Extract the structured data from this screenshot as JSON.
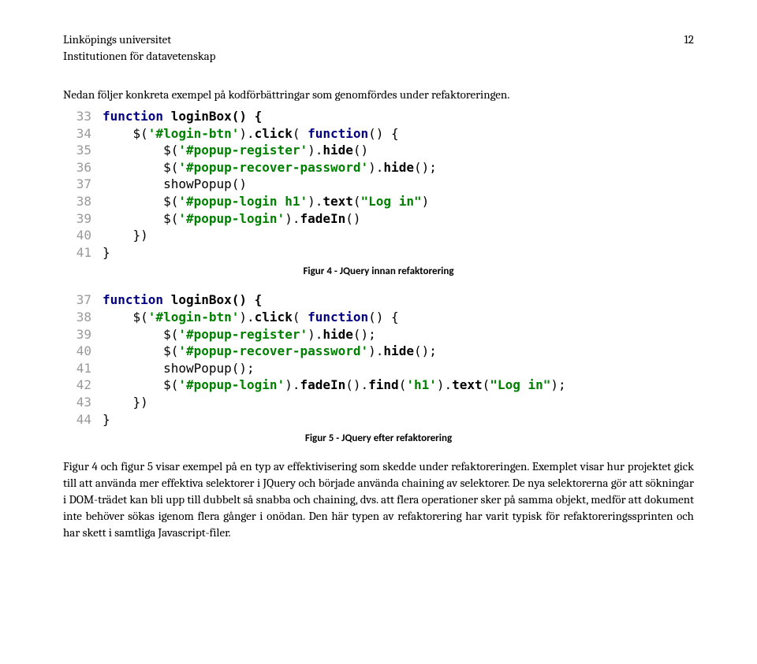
{
  "header": {
    "line1": "Linköpings universitet",
    "line2": "Institutionen för datavetenskap",
    "page_number": "12"
  },
  "intro": "Nedan följer konkreta exempel på kodförbättringar som genomfördes under refaktoreringen.",
  "code1": {
    "lines": [
      {
        "n": "33",
        "indent": 0,
        "tokens": [
          {
            "t": "function ",
            "c": "kw"
          },
          {
            "t": "loginBox() {",
            "c": "fn"
          }
        ]
      },
      {
        "n": "34",
        "indent": 1,
        "tokens": [
          {
            "t": "$(",
            "c": "plain"
          },
          {
            "t": "'#login-btn'",
            "c": "sel"
          },
          {
            "t": ").",
            "c": "plain"
          },
          {
            "t": "click",
            "c": "mtd"
          },
          {
            "t": "( ",
            "c": "plain"
          },
          {
            "t": "function",
            "c": "kw"
          },
          {
            "t": "() {",
            "c": "plain"
          }
        ]
      },
      {
        "n": "35",
        "indent": 2,
        "tokens": [
          {
            "t": "$(",
            "c": "plain"
          },
          {
            "t": "'#popup-register'",
            "c": "sel"
          },
          {
            "t": ").",
            "c": "plain"
          },
          {
            "t": "hide",
            "c": "mtd"
          },
          {
            "t": "()",
            "c": "plain"
          }
        ]
      },
      {
        "n": "36",
        "indent": 2,
        "tokens": [
          {
            "t": "$(",
            "c": "plain"
          },
          {
            "t": "'#popup-recover-password'",
            "c": "sel"
          },
          {
            "t": ").",
            "c": "plain"
          },
          {
            "t": "hide",
            "c": "mtd"
          },
          {
            "t": "();",
            "c": "plain"
          }
        ]
      },
      {
        "n": "37",
        "indent": 2,
        "tokens": [
          {
            "t": "showPopup()",
            "c": "plain"
          }
        ]
      },
      {
        "n": "38",
        "indent": 2,
        "tokens": [
          {
            "t": "$(",
            "c": "plain"
          },
          {
            "t": "'#popup-login h1'",
            "c": "sel"
          },
          {
            "t": ").",
            "c": "plain"
          },
          {
            "t": "text",
            "c": "mtd"
          },
          {
            "t": "(",
            "c": "plain"
          },
          {
            "t": "\"Log in\"",
            "c": "str"
          },
          {
            "t": ")",
            "c": "plain"
          }
        ]
      },
      {
        "n": "39",
        "indent": 2,
        "tokens": [
          {
            "t": "$(",
            "c": "plain"
          },
          {
            "t": "'#popup-login'",
            "c": "sel"
          },
          {
            "t": ").",
            "c": "plain"
          },
          {
            "t": "fadeIn",
            "c": "mtd"
          },
          {
            "t": "()",
            "c": "plain"
          }
        ]
      },
      {
        "n": "40",
        "indent": 1,
        "tokens": [
          {
            "t": "})",
            "c": "plain"
          }
        ]
      },
      {
        "n": "41",
        "indent": 0,
        "tokens": [
          {
            "t": "}",
            "c": "plain"
          }
        ]
      }
    ]
  },
  "caption1": "Figur 4 - JQuery innan refaktorering",
  "code2": {
    "lines": [
      {
        "n": "37",
        "indent": 0,
        "tokens": [
          {
            "t": "function ",
            "c": "kw"
          },
          {
            "t": "loginBox() {",
            "c": "fn"
          }
        ]
      },
      {
        "n": "38",
        "indent": 1,
        "tokens": [
          {
            "t": "$(",
            "c": "plain"
          },
          {
            "t": "'#login-btn'",
            "c": "sel"
          },
          {
            "t": ").",
            "c": "plain"
          },
          {
            "t": "click",
            "c": "mtd"
          },
          {
            "t": "( ",
            "c": "plain"
          },
          {
            "t": "function",
            "c": "kw"
          },
          {
            "t": "() {",
            "c": "plain"
          }
        ]
      },
      {
        "n": "39",
        "indent": 2,
        "tokens": [
          {
            "t": "$(",
            "c": "plain"
          },
          {
            "t": "'#popup-register'",
            "c": "sel"
          },
          {
            "t": ").",
            "c": "plain"
          },
          {
            "t": "hide",
            "c": "mtd"
          },
          {
            "t": "();",
            "c": "plain"
          }
        ]
      },
      {
        "n": "40",
        "indent": 2,
        "tokens": [
          {
            "t": "$(",
            "c": "plain"
          },
          {
            "t": "'#popup-recover-password'",
            "c": "sel"
          },
          {
            "t": ").",
            "c": "plain"
          },
          {
            "t": "hide",
            "c": "mtd"
          },
          {
            "t": "();",
            "c": "plain"
          }
        ]
      },
      {
        "n": "41",
        "indent": 2,
        "tokens": [
          {
            "t": "showPopup();",
            "c": "plain"
          }
        ]
      },
      {
        "n": "42",
        "indent": 2,
        "tokens": [
          {
            "t": "$(",
            "c": "plain"
          },
          {
            "t": "'#popup-login'",
            "c": "sel"
          },
          {
            "t": ").",
            "c": "plain"
          },
          {
            "t": "fadeIn",
            "c": "mtd"
          },
          {
            "t": "().",
            "c": "plain"
          },
          {
            "t": "find",
            "c": "mtd"
          },
          {
            "t": "(",
            "c": "plain"
          },
          {
            "t": "'h1'",
            "c": "str"
          },
          {
            "t": ").",
            "c": "plain"
          },
          {
            "t": "text",
            "c": "mtd"
          },
          {
            "t": "(",
            "c": "plain"
          },
          {
            "t": "\"Log in\"",
            "c": "str"
          },
          {
            "t": ");",
            "c": "plain"
          }
        ]
      },
      {
        "n": "43",
        "indent": 1,
        "tokens": [
          {
            "t": "})",
            "c": "plain"
          }
        ]
      },
      {
        "n": "44",
        "indent": 0,
        "tokens": [
          {
            "t": "}",
            "c": "plain"
          }
        ]
      },
      {
        "n": "",
        "indent": 0,
        "tokens": []
      }
    ]
  },
  "caption2": "Figur 5 - JQuery efter refaktorering",
  "body": "Figur 4 och figur 5 visar exempel på en typ av effektivisering som skedde under refaktoreringen. Exemplet visar hur projektet gick till att använda mer effektiva selektorer i JQuery och började använda chaining av selektorer. De nya selektorerna gör att sökningar i DOM-trädet kan bli upp till dubbelt så snabba och chaining, dvs. att flera operationer sker på samma objekt, medför att dokument inte behöver sökas igenom flera gånger i onödan. Den här typen av refaktorering har varit typisk för refaktoreringssprinten och har skett i samtliga Javascript-filer."
}
